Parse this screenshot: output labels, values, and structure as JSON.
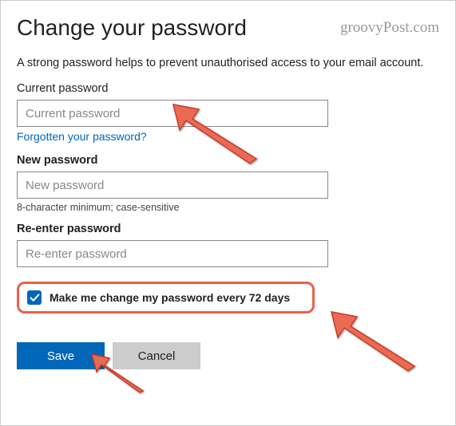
{
  "header": {
    "title": "Change your password",
    "watermark": "groovyPost.com"
  },
  "help_text": "A strong password helps to prevent unauthorised access to your email account.",
  "fields": {
    "current": {
      "label": "Current password",
      "placeholder": "Current password",
      "forgot_link": "Forgotten your password?"
    },
    "new": {
      "label": "New password",
      "placeholder": "New password",
      "hint": "8-character minimum; case-sensitive"
    },
    "reenter": {
      "label": "Re-enter password",
      "placeholder": "Re-enter password"
    }
  },
  "checkbox": {
    "checked": true,
    "label": "Make me change my password every 72 days"
  },
  "buttons": {
    "save": "Save",
    "cancel": "Cancel"
  }
}
